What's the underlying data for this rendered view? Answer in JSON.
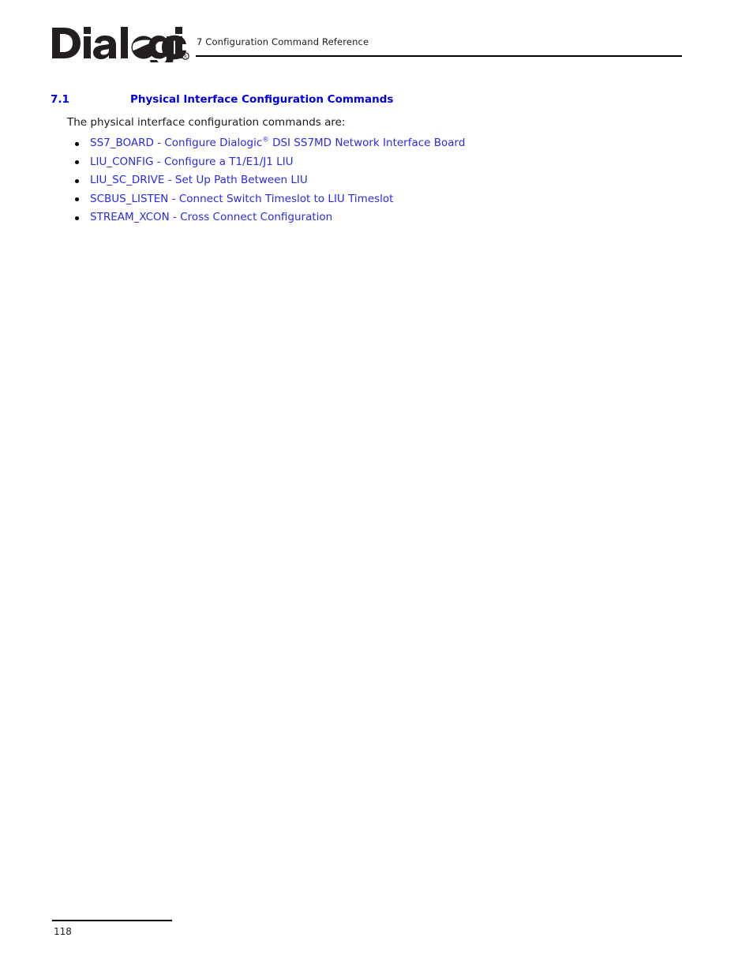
{
  "header": {
    "logo_text": "Dialogic",
    "logo_registered_mark": "®",
    "logo_icon": "dialogic-swoosh-o-logo",
    "running_head": "7 Configuration Command Reference"
  },
  "section": {
    "number": "7.1",
    "title": "Physical Interface Configuration Commands",
    "intro": "The physical interface configuration commands are:"
  },
  "commands": [
    {
      "name": "SS7_BOARD",
      "separator": " - ",
      "description_before_mark": "Configure Dialogic",
      "registered_mark": "®",
      "description_after_mark": " DSI SS7MD Network Interface Board",
      "has_registered_mark": true
    },
    {
      "name": "LIU_CONFIG",
      "separator": " - ",
      "description_before_mark": "Configure a T1/E1/J1 LIU",
      "registered_mark": "",
      "description_after_mark": "",
      "has_registered_mark": false
    },
    {
      "name": "LIU_SC_DRIVE",
      "separator": " - ",
      "description_before_mark": "Set Up Path Between LIU",
      "registered_mark": "",
      "description_after_mark": "",
      "has_registered_mark": false
    },
    {
      "name": "SCBUS_LISTEN",
      "separator": " - ",
      "description_before_mark": "Connect Switch Timeslot to LIU Timeslot",
      "registered_mark": "",
      "description_after_mark": "",
      "has_registered_mark": false
    },
    {
      "name": "STREAM_XCON",
      "separator": " - ",
      "description_before_mark": "Cross Connect Configuration",
      "registered_mark": "",
      "description_after_mark": "",
      "has_registered_mark": false
    }
  ],
  "footer": {
    "page_number": "118"
  },
  "colors": {
    "heading_blue": "#0000dd",
    "link_blue": "#2a2ae6",
    "body_text": "#1a1a1a",
    "rule": "#000000"
  }
}
